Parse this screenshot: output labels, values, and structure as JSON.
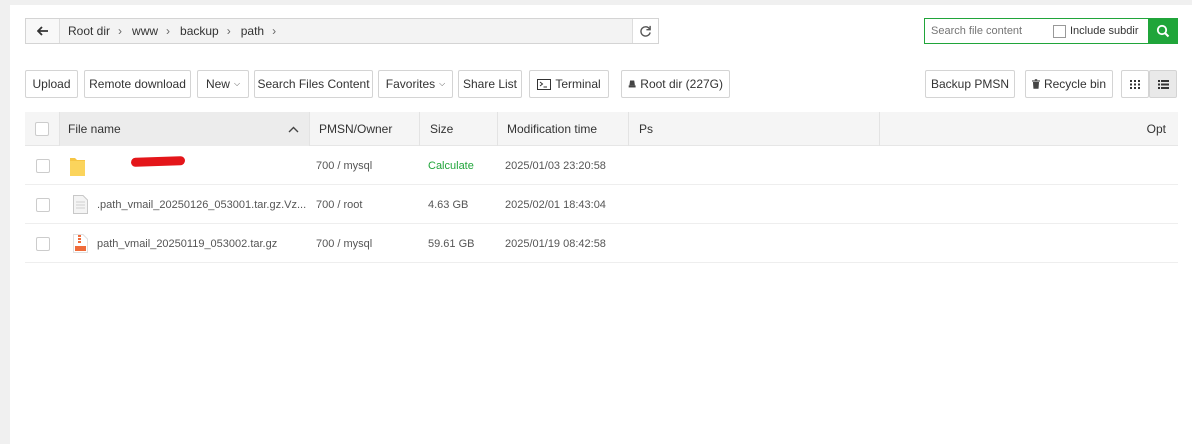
{
  "breadcrumb": [
    "Root dir",
    "www",
    "backup",
    "path"
  ],
  "search": {
    "placeholder": "Search file content",
    "include_subdir": "Include subdir"
  },
  "toolbar": {
    "upload": "Upload",
    "remote_download": "Remote download",
    "new": "New",
    "search_files": "Search Files Content",
    "favorites": "Favorites",
    "share_list": "Share List",
    "terminal": "Terminal",
    "root_dir": "Root dir (227G)",
    "backup_pmsn": "Backup PMSN",
    "recycle_bin": "Recycle bin"
  },
  "table": {
    "headers": {
      "name": "File name",
      "perm": "PMSN/Owner",
      "size": "Size",
      "mtime": "Modification time",
      "ps": "Ps",
      "opt": "Opt"
    },
    "rows": [
      {
        "name": "",
        "perm": "700 / mysql",
        "size": "Calculate",
        "mtime": "2025/01/03 23:20:58",
        "type": "folder",
        "redacted": true
      },
      {
        "name": ".path_vmail_20250126_053001.tar.gz.Vz...",
        "perm": "700 / root",
        "size": "4.63 GB",
        "mtime": "2025/02/01 18:43:04",
        "type": "file"
      },
      {
        "name": "path_vmail_20250119_053002.tar.gz",
        "perm": "700 / mysql",
        "size": "59.61 GB",
        "mtime": "2025/01/19 08:42:58",
        "type": "archive"
      }
    ]
  },
  "colors": {
    "accent": "#20a53a",
    "redaction": "#e4161a"
  }
}
